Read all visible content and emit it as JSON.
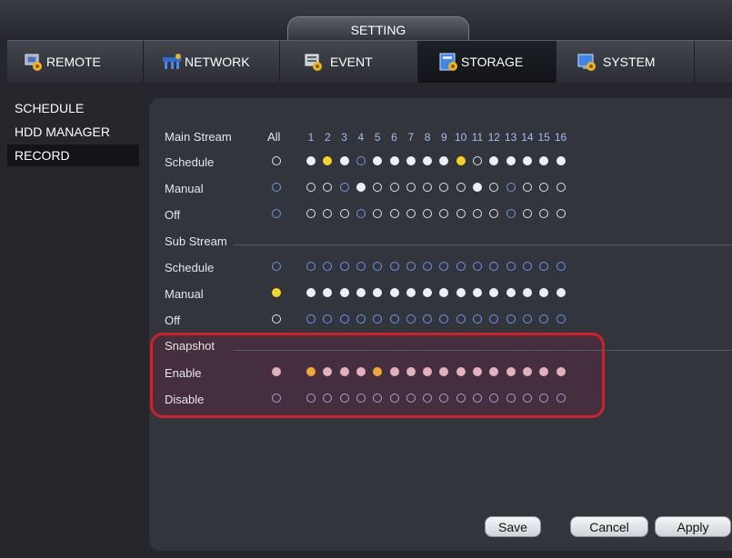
{
  "window": {
    "title": "SETTING"
  },
  "tabs": [
    {
      "label": "REMOTE",
      "icon": "remote-icon"
    },
    {
      "label": "NETWORK",
      "icon": "network-icon"
    },
    {
      "label": "EVENT",
      "icon": "event-icon"
    },
    {
      "label": "STORAGE",
      "icon": "storage-icon",
      "active": true
    },
    {
      "label": "SYSTEM",
      "icon": "system-icon"
    }
  ],
  "sidebar": {
    "items": [
      {
        "label": "SCHEDULE"
      },
      {
        "label": "HDD MANAGER"
      },
      {
        "label": "RECORD",
        "active": true
      }
    ]
  },
  "record": {
    "main_stream_label": "Main Stream",
    "all_label": "All",
    "channels": [
      "1",
      "2",
      "3",
      "4",
      "5",
      "6",
      "7",
      "8",
      "9",
      "10",
      "11",
      "12",
      "13",
      "14",
      "15",
      "16"
    ],
    "sub_stream_label": "Sub Stream",
    "snapshot_label": "Snapshot",
    "rows": [
      {
        "key": "main_schedule",
        "label": "Schedule",
        "all": "empty-white",
        "dots": [
          "fill-white",
          "fill-yellow",
          "fill-white",
          "empty-blue",
          "fill-white",
          "fill-white",
          "fill-white",
          "fill-white",
          "fill-white",
          "fill-yellow",
          "empty-white",
          "fill-white",
          "fill-white",
          "fill-white",
          "fill-white",
          "fill-white"
        ]
      },
      {
        "key": "main_manual",
        "label": "Manual",
        "all": "empty-blue",
        "dots": [
          "empty-white",
          "empty-white",
          "empty-blue",
          "fill-white",
          "empty-white",
          "empty-white",
          "empty-white",
          "empty-white",
          "empty-white",
          "empty-white",
          "fill-white",
          "empty-white",
          "empty-blue",
          "empty-white",
          "empty-white",
          "empty-white"
        ]
      },
      {
        "key": "main_off",
        "label": "Off",
        "all": "empty-blue",
        "dots": [
          "empty-white",
          "empty-white",
          "empty-white",
          "empty-blue",
          "empty-white",
          "empty-white",
          "empty-white",
          "empty-white",
          "empty-white",
          "empty-white",
          "empty-white",
          "empty-white",
          "empty-blue",
          "empty-white",
          "empty-white",
          "empty-white"
        ]
      },
      {
        "key": "sub_schedule",
        "label": "Schedule",
        "all": "empty-blue",
        "dots": [
          "empty-blue",
          "empty-blue",
          "empty-blue",
          "empty-blue",
          "empty-blue",
          "empty-blue",
          "empty-blue",
          "empty-blue",
          "empty-blue",
          "empty-blue",
          "empty-blue",
          "empty-blue",
          "empty-blue",
          "empty-blue",
          "empty-blue",
          "empty-blue"
        ]
      },
      {
        "key": "sub_manual",
        "label": "Manual",
        "all": "fill-yellow",
        "dots": [
          "fill-white",
          "fill-white",
          "fill-white",
          "fill-white",
          "fill-white",
          "fill-white",
          "fill-white",
          "fill-white",
          "fill-white",
          "fill-white",
          "fill-white",
          "fill-white",
          "fill-white",
          "fill-white",
          "fill-white",
          "fill-white"
        ]
      },
      {
        "key": "sub_off",
        "label": "Off",
        "all": "empty-white",
        "dots": [
          "empty-blue",
          "empty-blue",
          "empty-blue",
          "empty-blue",
          "empty-blue",
          "empty-blue",
          "empty-blue",
          "empty-blue",
          "empty-blue",
          "empty-blue",
          "empty-blue",
          "empty-blue",
          "empty-blue",
          "empty-blue",
          "empty-blue",
          "empty-blue"
        ]
      },
      {
        "key": "snap_enable",
        "label": "Enable",
        "all": "fill-pink",
        "dots": [
          "fill-orange",
          "fill-pink",
          "fill-pink",
          "fill-pink",
          "fill-orange",
          "fill-pink",
          "fill-pink",
          "fill-pink",
          "fill-pink",
          "fill-pink",
          "fill-pink",
          "fill-pink",
          "fill-pink",
          "fill-pink",
          "fill-pink",
          "fill-pink"
        ]
      },
      {
        "key": "snap_disable",
        "label": "Disable",
        "all": "empty-purple",
        "dots": [
          "empty-purple",
          "empty-purple",
          "empty-purple",
          "empty-purple",
          "empty-purple",
          "empty-purple",
          "empty-purple",
          "empty-purple",
          "empty-purple",
          "empty-purple",
          "empty-purple",
          "empty-purple",
          "empty-purple",
          "empty-purple",
          "empty-purple",
          "empty-purple"
        ]
      }
    ]
  },
  "buttons": {
    "save": "Save",
    "cancel": "Cancel",
    "apply": "Apply"
  },
  "colors": {
    "highlight_box": "#d1202a",
    "selected_dot": "#f5d327",
    "channel_header": "#9fbef0"
  }
}
